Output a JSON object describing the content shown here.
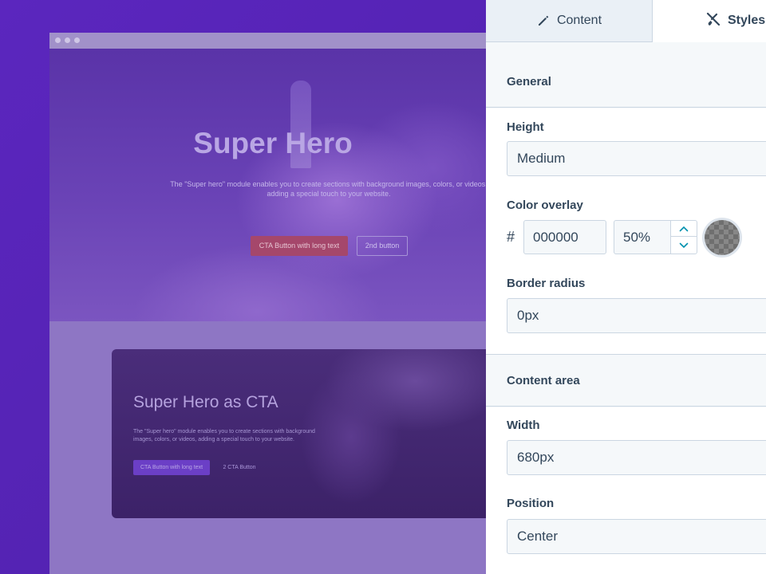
{
  "preview": {
    "hero": {
      "title": "Super Hero",
      "description": "The \"Super hero\" module enables you to create sections with background images, colors, or videos, adding a special touch to your website.",
      "cta_label": "CTA Button with long text",
      "second_label": "2nd button"
    },
    "cta_card": {
      "title": "Super Hero as CTA",
      "description": "The \"Super hero\" module enables you to create sections with background images, colors, or videos, adding a special touch to your website.",
      "cta_label": "CTA Button with long text",
      "second_label": "2 CTA Button"
    }
  },
  "panel": {
    "tabs": [
      {
        "label": "Content",
        "icon": "pencil-icon"
      },
      {
        "label": "Styles",
        "icon": "brush-icon"
      }
    ],
    "general": {
      "heading": "General",
      "height_label": "Height",
      "height_value": "Medium",
      "color_overlay_label": "Color overlay",
      "hash": "#",
      "color_hex": "000000",
      "opacity": "50%",
      "border_radius_label": "Border radius",
      "border_radius_value": "0px"
    },
    "content_area": {
      "heading": "Content area",
      "width_label": "Width",
      "width_value": "680px",
      "position_label": "Position",
      "position_value": "Center"
    }
  },
  "colors": {
    "background": "#5a24b8",
    "panel": "#f5f8fa",
    "text": "#33475b",
    "accent": "#00a4bd"
  }
}
